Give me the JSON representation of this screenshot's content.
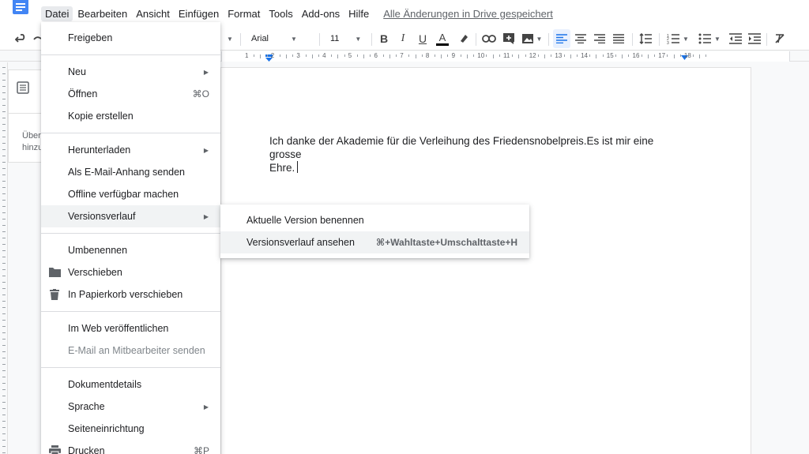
{
  "menubar": {
    "items": [
      "Datei",
      "Bearbeiten",
      "Ansicht",
      "Einfügen",
      "Format",
      "Tools",
      "Add-ons",
      "Hilfe"
    ],
    "active": "Datei",
    "save_status": "Alle Änderungen in Drive gespeichert"
  },
  "toolbar": {
    "font": "Arial",
    "font_size": "11",
    "icons": [
      "undo-icon",
      "redo-icon",
      "bold-icon",
      "italic-icon",
      "underline-icon",
      "text-color-icon",
      "highlight-icon",
      "link-icon",
      "comment-icon",
      "image-icon",
      "align-left-icon",
      "align-center-icon",
      "align-right-icon",
      "justify-icon",
      "line-spacing-icon",
      "numbered-list-icon",
      "bulleted-list-icon",
      "decrease-indent-icon",
      "increase-indent-icon",
      "clear-formatting-icon"
    ]
  },
  "ruler": {
    "labels": [
      "1",
      "2",
      "3",
      "4",
      "5",
      "6",
      "7",
      "8",
      "9",
      "10",
      "11",
      "12",
      "13",
      "14",
      "15",
      "16",
      "17",
      "18"
    ]
  },
  "outline": {
    "hint_line1": "Über",
    "hint_line2": "hinzu"
  },
  "file_menu": {
    "share": "Freigeben",
    "new": "Neu",
    "open": "Öffnen",
    "open_shortcut": "⌘O",
    "copy": "Kopie erstellen",
    "download": "Herunterladen",
    "email_attachment": "Als E-Mail-Anhang senden",
    "offline": "Offline verfügbar machen",
    "version_history": "Versionsverlauf",
    "rename": "Umbenennen",
    "move": "Verschieben",
    "trash": "In Papierkorb verschieben",
    "publish": "Im Web veröffentlichen",
    "email_collaborators": "E-Mail an Mitbearbeiter senden",
    "details": "Dokumentdetails",
    "language": "Sprache",
    "page_setup": "Seiteneinrichtung",
    "print": "Drucken",
    "print_shortcut": "⌘P"
  },
  "submenu": {
    "name_version": "Aktuelle Version benennen",
    "view_history": "Versionsverlauf ansehen",
    "view_history_shortcut": "⌘+Wahltaste+Umschalttaste+H"
  },
  "document": {
    "line1": "Ich danke der Akademie für die Verleihung des Friedensnobelpreis.Es ist mir eine grosse",
    "line2": "Ehre."
  },
  "colors": {
    "accent": "#1a73e8",
    "menu_highlight": "#f1f3f4",
    "toolbar_active": "#e8f0fe"
  }
}
